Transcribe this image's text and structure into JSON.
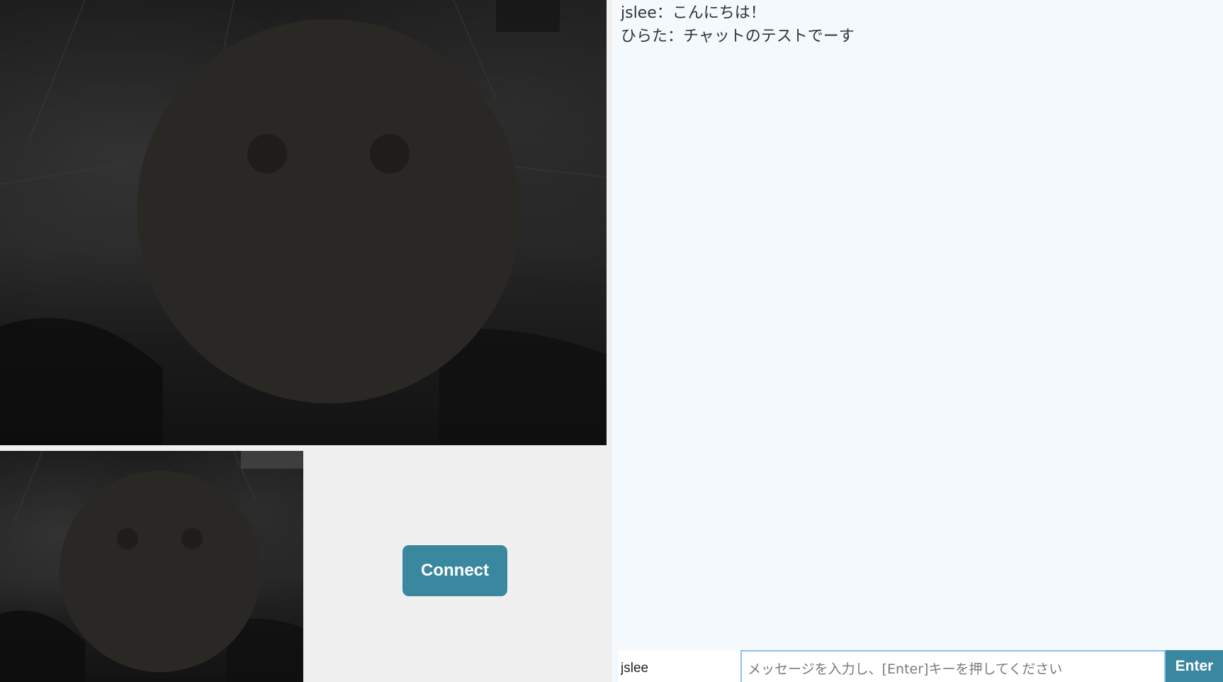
{
  "video": {
    "remote_label": "remote-video",
    "local_label": "local-video"
  },
  "controls": {
    "connect_label": "Connect"
  },
  "chat": {
    "messages": [
      "jslee：こんにちは！",
      "ひらた：チャットのテストでーす"
    ],
    "form": {
      "username_value": "jslee",
      "message_value": "",
      "message_placeholder": "メッセージを入力し、[Enter]キーを押してください",
      "enter_label": "Enter"
    }
  },
  "colors": {
    "accent": "#3a88a0",
    "chat_background": "#f4f9fe",
    "page_background": "#f0f0f0",
    "avatar_fill": "#2a2824"
  }
}
